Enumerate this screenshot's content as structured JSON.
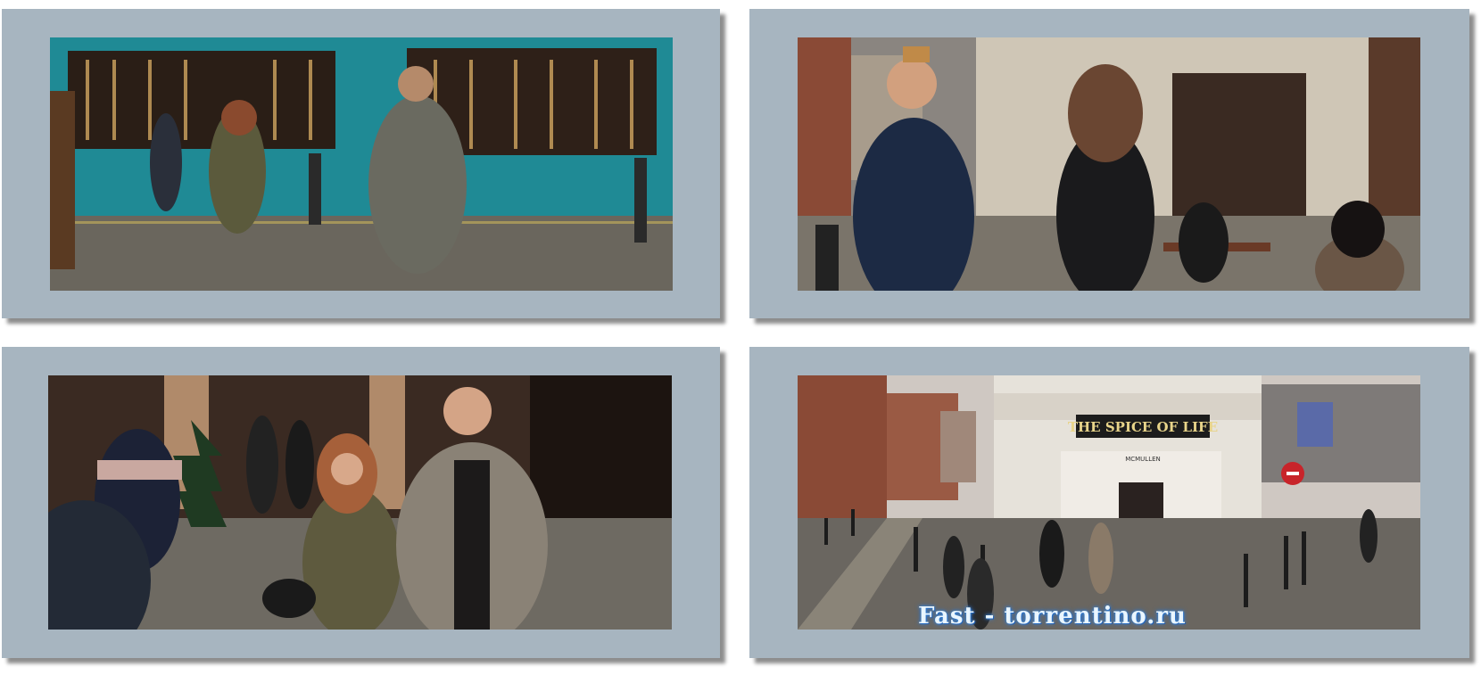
{
  "stills": [
    {
      "scene": "street-teal-shopfront"
    },
    {
      "scene": "street-cafe-conversation"
    },
    {
      "scene": "street-couple-smiling"
    },
    {
      "scene": "street-corner-pub"
    }
  ],
  "pub_sign": "THE SPICE OF LIFE",
  "pub_subsign": "MCMULLEN",
  "watermark": "Fast - torrentino.ru",
  "colors": {
    "panel": "#a7b5c0",
    "teal": "#1f8a95",
    "watermark": "#eaf6ff"
  }
}
